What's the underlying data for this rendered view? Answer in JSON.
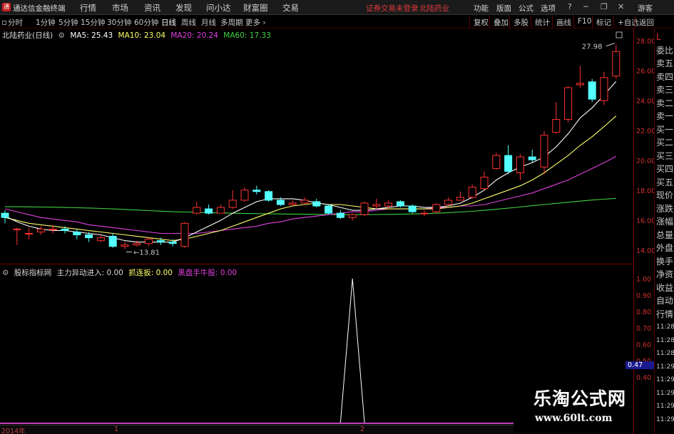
{
  "menubar": {
    "app_name": "通达信金融终端",
    "items": [
      "行情",
      "市场",
      "资讯",
      "发现",
      "问小达",
      "财富圈",
      "交易"
    ],
    "notice": "证券交易未登录",
    "stock_name": "北陆药业",
    "right_items": [
      "功能",
      "版面",
      "公式",
      "选项"
    ],
    "guest": "游客"
  },
  "toolbar": {
    "periods": [
      "分时",
      "1分钟",
      "5分钟",
      "15分钟",
      "30分钟",
      "60分钟",
      "日线",
      "周线",
      "月线",
      "多周期",
      "更多"
    ],
    "active_period": "日线",
    "tools": [
      "复权",
      "叠加",
      "多股",
      "统计",
      "画线",
      "F10",
      "标记",
      "+自选",
      "返回"
    ]
  },
  "main_legend": {
    "title": "北陆药业(日线)",
    "ma5": "MA5: 25.43",
    "ma10": "MA10: 23.04",
    "ma20": "MA20: 20.24",
    "ma60": "MA60: 17.33"
  },
  "price_axis": {
    "ticks": [
      "28.00",
      "26.00",
      "24.00",
      "22.00",
      "20.00",
      "18.00",
      "16.00",
      "14.00"
    ],
    "high_label": "27.98",
    "low_label": "13.81"
  },
  "sub_legend": {
    "title": "股标指标网",
    "main_force": "主力异动进入: 0.00",
    "grab": "抓连扳: 0.00",
    "dark_horse": "黑盘手牛股: 0.00"
  },
  "sub_axis": {
    "ticks": [
      "1.00",
      "0.90",
      "0.80",
      "0.70",
      "0.60",
      "0.50",
      "0.40"
    ],
    "current": "0.47"
  },
  "side_panel": {
    "items": [
      "L",
      "委比",
      "卖五",
      "卖四",
      "卖三",
      "卖二",
      "卖一",
      "买一",
      "买二",
      "买三",
      "买四",
      "买五",
      "现价",
      "涨跌",
      "涨幅",
      "总量",
      "外盘",
      "换手",
      "净资",
      "收益",
      "自动",
      "行情",
      "11:28",
      "11:28",
      "11:28",
      "11:29",
      "11:29",
      "11:29",
      "11:29",
      "11:29"
    ]
  },
  "date_axis": {
    "labels": [
      "2014年",
      "1",
      "2"
    ]
  },
  "watermark": {
    "title": "乐淘公式网",
    "url": "www.60lt.com"
  },
  "colors": {
    "up": "#ff3232",
    "down": "#54ffff",
    "ma5": "#ffffff",
    "ma10": "#ffff6a",
    "ma20": "#e040e0",
    "ma60": "#40d040",
    "axis": "#d03030"
  },
  "chart_data": {
    "type": "candlestick",
    "title": "北陆药业(日线)",
    "ylim": [
      13.0,
      28.8
    ],
    "candles": [
      {
        "o": 16.3,
        "c": 16.0,
        "h": 16.5,
        "l": 15.6
      },
      {
        "o": 15.2,
        "c": 15.2,
        "h": 15.3,
        "l": 14.1
      },
      {
        "o": 14.9,
        "c": 14.9,
        "h": 15.3,
        "l": 14.5
      },
      {
        "o": 15.0,
        "c": 15.2,
        "h": 15.4,
        "l": 14.8
      },
      {
        "o": 15.2,
        "c": 15.2,
        "h": 15.5,
        "l": 14.9
      },
      {
        "o": 15.2,
        "c": 15.1,
        "h": 15.4,
        "l": 14.9
      },
      {
        "o": 15.0,
        "c": 14.8,
        "h": 15.2,
        "l": 14.5
      },
      {
        "o": 14.8,
        "c": 14.6,
        "h": 15.0,
        "l": 14.3
      },
      {
        "o": 14.4,
        "c": 14.6,
        "h": 14.8,
        "l": 14.3
      },
      {
        "o": 14.7,
        "c": 14.0,
        "h": 14.9,
        "l": 13.9
      },
      {
        "o": 14.0,
        "c": 14.1,
        "h": 14.3,
        "l": 13.81
      },
      {
        "o": 14.1,
        "c": 14.2,
        "h": 14.4,
        "l": 14.0
      },
      {
        "o": 14.2,
        "c": 14.5,
        "h": 14.6,
        "l": 14.0
      },
      {
        "o": 14.4,
        "c": 14.3,
        "h": 14.6,
        "l": 14.1
      },
      {
        "o": 14.3,
        "c": 14.2,
        "h": 14.5,
        "l": 14.0
      },
      {
        "o": 14.0,
        "c": 15.6,
        "h": 15.7,
        "l": 13.9
      },
      {
        "o": 16.3,
        "c": 16.7,
        "h": 17.1,
        "l": 16.2
      },
      {
        "o": 16.6,
        "c": 16.3,
        "h": 16.9,
        "l": 16.2
      },
      {
        "o": 16.3,
        "c": 16.7,
        "h": 16.9,
        "l": 16.3
      },
      {
        "o": 16.7,
        "c": 17.2,
        "h": 17.9,
        "l": 16.6
      },
      {
        "o": 17.2,
        "c": 17.9,
        "h": 18.1,
        "l": 17.1
      },
      {
        "o": 17.9,
        "c": 17.8,
        "h": 18.2,
        "l": 17.6
      },
      {
        "o": 17.8,
        "c": 17.2,
        "h": 17.9,
        "l": 17.1
      },
      {
        "o": 17.2,
        "c": 16.9,
        "h": 17.4,
        "l": 16.8
      },
      {
        "o": 16.9,
        "c": 17.0,
        "h": 17.2,
        "l": 16.8
      },
      {
        "o": 17.0,
        "c": 17.2,
        "h": 17.4,
        "l": 16.9
      },
      {
        "o": 17.1,
        "c": 16.8,
        "h": 17.3,
        "l": 16.7
      },
      {
        "o": 16.8,
        "c": 16.3,
        "h": 16.9,
        "l": 16.2
      },
      {
        "o": 16.3,
        "c": 16.0,
        "h": 16.5,
        "l": 15.9
      },
      {
        "o": 16.0,
        "c": 16.2,
        "h": 16.3,
        "l": 15.8
      },
      {
        "o": 16.2,
        "c": 17.0,
        "h": 17.1,
        "l": 16.1
      },
      {
        "o": 16.8,
        "c": 16.9,
        "h": 17.3,
        "l": 16.6
      },
      {
        "o": 16.8,
        "c": 17.0,
        "h": 17.2,
        "l": 16.6
      },
      {
        "o": 17.1,
        "c": 16.8,
        "h": 17.2,
        "l": 16.7
      },
      {
        "o": 16.8,
        "c": 16.4,
        "h": 16.9,
        "l": 16.3
      },
      {
        "o": 16.3,
        "c": 16.3,
        "h": 16.5,
        "l": 16.1
      },
      {
        "o": 16.4,
        "c": 16.9,
        "h": 17.0,
        "l": 16.3
      },
      {
        "o": 16.9,
        "c": 17.2,
        "h": 17.4,
        "l": 16.8
      },
      {
        "o": 17.2,
        "c": 17.4,
        "h": 17.8,
        "l": 17.2
      },
      {
        "o": 17.4,
        "c": 18.1,
        "h": 18.3,
        "l": 17.3
      },
      {
        "o": 18.0,
        "c": 18.8,
        "h": 19.2,
        "l": 17.9
      },
      {
        "o": 19.4,
        "c": 20.3,
        "h": 20.5,
        "l": 19.3
      },
      {
        "o": 20.3,
        "c": 19.2,
        "h": 21.0,
        "l": 19.0
      },
      {
        "o": 19.1,
        "c": 20.2,
        "h": 20.4,
        "l": 18.6
      },
      {
        "o": 20.2,
        "c": 20.0,
        "h": 20.7,
        "l": 19.8
      },
      {
        "o": 19.5,
        "c": 21.7,
        "h": 22.0,
        "l": 19.0
      },
      {
        "o": 21.9,
        "c": 22.8,
        "h": 24.0,
        "l": 21.8
      },
      {
        "o": 22.8,
        "c": 25.0,
        "h": 25.1,
        "l": 22.6
      },
      {
        "o": 25.2,
        "c": 25.3,
        "h": 26.5,
        "l": 25.0
      },
      {
        "o": 25.4,
        "c": 24.2,
        "h": 25.6,
        "l": 24.0
      },
      {
        "o": 24.1,
        "c": 25.7,
        "h": 26.1,
        "l": 23.8
      },
      {
        "o": 25.8,
        "c": 27.5,
        "h": 27.98,
        "l": 25.6
      }
    ],
    "ma5": [
      16.1,
      15.7,
      15.4,
      15.2,
      15.1,
      15.1,
      15.0,
      14.9,
      14.8,
      14.6,
      14.4,
      14.3,
      14.3,
      14.3,
      14.3,
      14.6,
      15.0,
      15.4,
      15.8,
      16.3,
      16.7,
      17.1,
      17.3,
      17.3,
      17.3,
      17.2,
      17.0,
      16.9,
      16.7,
      16.5,
      16.5,
      16.6,
      16.7,
      16.8,
      16.8,
      16.7,
      16.7,
      16.8,
      17.0,
      17.4,
      17.9,
      18.6,
      19.1,
      19.5,
      19.8,
      20.2,
      20.9,
      21.8,
      22.9,
      23.6,
      24.5,
      25.43
    ],
    "ma10": [
      16.0,
      15.8,
      15.6,
      15.5,
      15.4,
      15.3,
      15.2,
      15.1,
      15.0,
      14.9,
      14.8,
      14.7,
      14.6,
      14.5,
      14.4,
      14.5,
      14.7,
      14.9,
      15.1,
      15.4,
      15.7,
      16.0,
      16.3,
      16.6,
      16.8,
      16.9,
      17.0,
      16.9,
      16.9,
      16.8,
      16.7,
      16.6,
      16.6,
      16.6,
      16.6,
      16.6,
      16.6,
      16.7,
      16.8,
      17.0,
      17.3,
      17.6,
      17.9,
      18.2,
      18.6,
      19.1,
      19.7,
      20.3,
      21.0,
      21.6,
      22.3,
      23.04
    ],
    "ma20": [
      16.6,
      16.4,
      16.2,
      16.0,
      15.9,
      15.8,
      15.7,
      15.5,
      15.4,
      15.3,
      15.2,
      15.1,
      15.0,
      14.9,
      14.9,
      14.9,
      14.9,
      15.0,
      15.1,
      15.2,
      15.3,
      15.4,
      15.6,
      15.7,
      15.9,
      16.0,
      16.1,
      16.2,
      16.3,
      16.4,
      16.4,
      16.5,
      16.6,
      16.6,
      16.6,
      16.6,
      16.7,
      16.7,
      16.8,
      16.8,
      16.9,
      17.1,
      17.3,
      17.5,
      17.7,
      18.0,
      18.3,
      18.6,
      19.0,
      19.4,
      19.8,
      20.24
    ],
    "ma60": [
      16.75,
      16.75,
      16.74,
      16.73,
      16.72,
      16.7,
      16.68,
      16.66,
      16.63,
      16.6,
      16.56,
      16.52,
      16.48,
      16.44,
      16.4,
      16.38,
      16.36,
      16.34,
      16.32,
      16.3,
      16.28,
      16.27,
      16.26,
      16.25,
      16.24,
      16.23,
      16.22,
      16.21,
      16.2,
      16.2,
      16.2,
      16.21,
      16.22,
      16.23,
      16.25,
      16.27,
      16.3,
      16.34,
      16.38,
      16.43,
      16.5,
      16.57,
      16.65,
      16.73,
      16.82,
      16.9,
      16.98,
      17.06,
      17.14,
      17.21,
      17.27,
      17.33
    ],
    "sub_indicator": {
      "ylim": [
        0.4,
        1.0
      ],
      "spike_at": 29,
      "spike_value": 1.0
    }
  }
}
